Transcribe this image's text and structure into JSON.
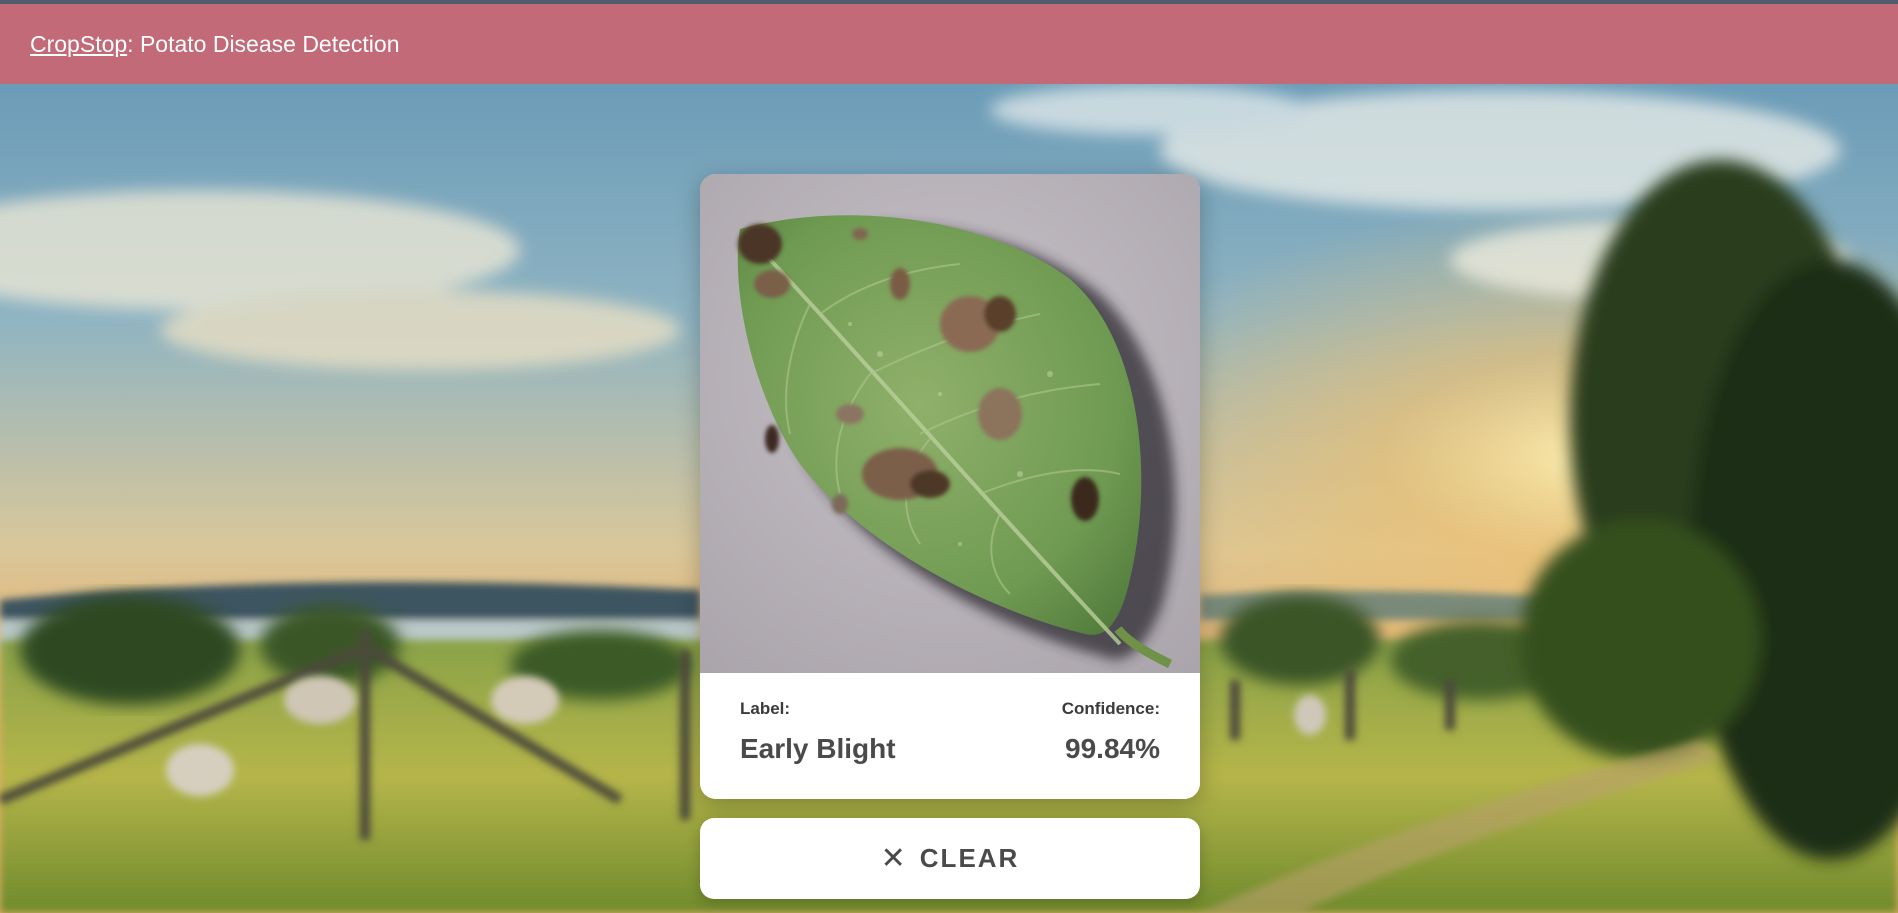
{
  "header": {
    "brand": "CropStop",
    "title_suffix": ": Potato Disease Detection"
  },
  "card": {
    "image_subject": "potato leaf with blight spots",
    "label_caption": "Label:",
    "label_value": "Early Blight",
    "confidence_caption": "Confidence:",
    "confidence_value": "99.84%"
  },
  "clear_button": {
    "icon": "close-icon",
    "label": "CLEAR"
  },
  "colors": {
    "header_bg": "#c26a78",
    "header_border": "#4e5c6c",
    "card_bg": "#ffffff",
    "text_dark": "#4a4a4a"
  }
}
